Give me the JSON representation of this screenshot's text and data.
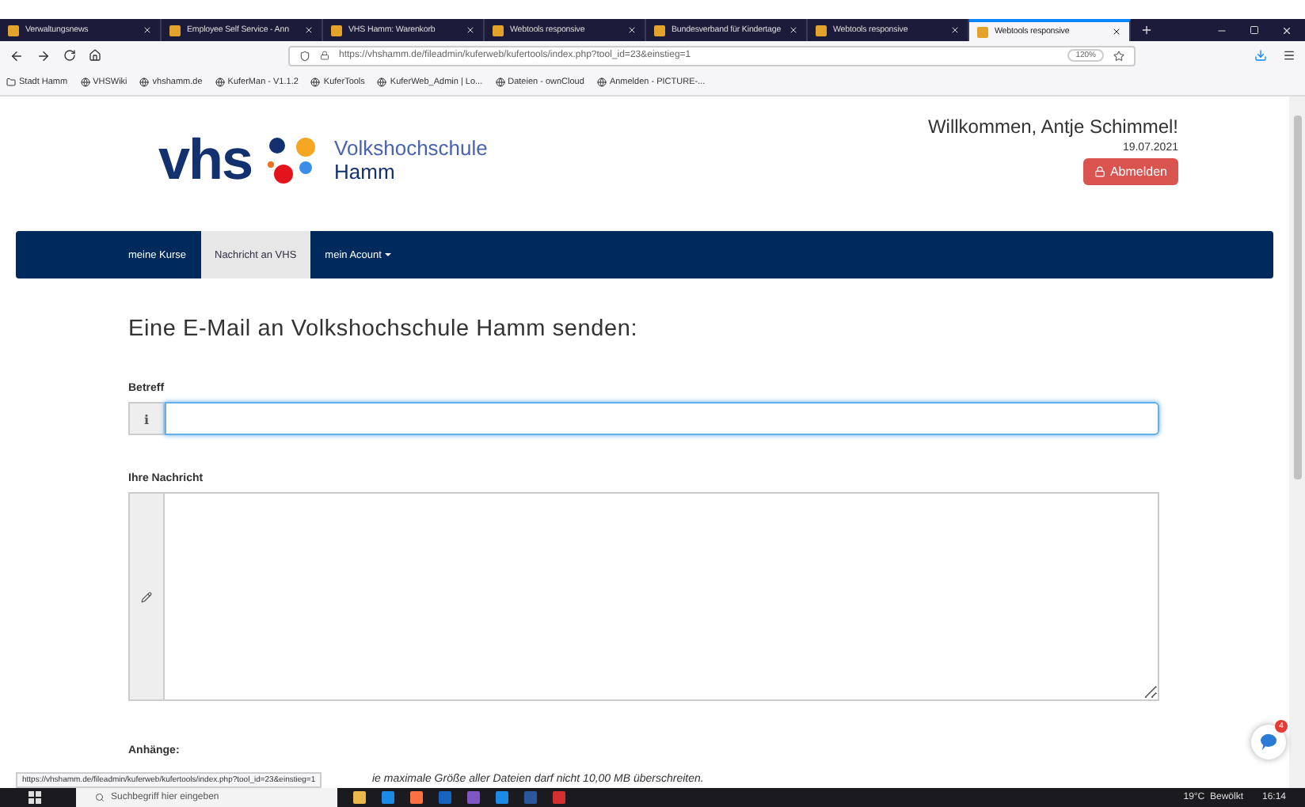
{
  "browser": {
    "tabs": [
      {
        "label": "Verwaltungsnews",
        "selected": false
      },
      {
        "label": "Employee Self Service - Ann",
        "selected": false
      },
      {
        "label": "VHS Hamm: Warenkorb",
        "selected": false
      },
      {
        "label": "Webtools responsive",
        "selected": false
      },
      {
        "label": "Bundesverband für Kindertage",
        "selected": false
      },
      {
        "label": "Webtools responsive",
        "selected": false
      },
      {
        "label": "Webtools responsive",
        "selected": true
      }
    ],
    "url": "https://vhshamm.de/fileadmin/kuferweb/kufertools/index.php?tool_id=23&einstieg=1",
    "zoom": "120%",
    "bookmarks": [
      "Stadt Hamm",
      "VHSWiki",
      "vhshamm.de",
      "KuferMan - V1.1.2",
      "KuferTools",
      "KuferWeb_Admin | Lo...",
      "Dateien - ownCloud",
      "Anmelden - PICTURE-..."
    ]
  },
  "header": {
    "brand": "vhs",
    "name_line_1": "Volkshochschule",
    "name_line_2": "Hamm",
    "welcome": "Willkommen, Antje Schimmel!",
    "date": "19.07.2021",
    "logout": "Abmelden"
  },
  "nav": [
    {
      "label": "meine Kurse",
      "selected": false,
      "dropdown": false
    },
    {
      "label": "Nachricht an VHS",
      "selected": true,
      "dropdown": false
    },
    {
      "label": "mein Acount",
      "selected": false,
      "dropdown": true
    }
  ],
  "form": {
    "heading": "Eine E-Mail an Volkshochschule Hamm senden:",
    "subject_label": "Betreff",
    "subject_addon": "i",
    "message_label": "Ihre Nachricht",
    "attachments_label": "Anhänge:",
    "attachments_note": "ie maximale Größe aller Dateien darf nicht 10,00 MB überschreiten."
  },
  "chat_badge": "4",
  "status_url": "https://vhshamm.de/fileadmin/kuferweb/kufertools/index.php?tool_id=23&einstieg=1",
  "taskbar": {
    "search_placeholder": "Suchbegriff hier eingeben",
    "weather": "19°C  Bewölkt",
    "time": "16:14"
  }
}
